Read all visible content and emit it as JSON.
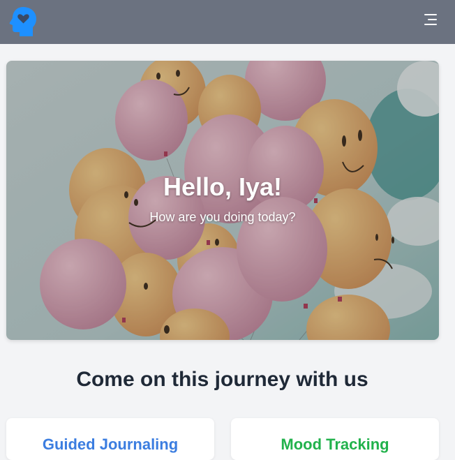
{
  "header": {
    "logo_icon": "head-heart-icon",
    "menu_icon": "hamburger-menu-icon",
    "background_color": "#6b7280",
    "logo_color": "#1e90ff"
  },
  "hero": {
    "greeting": "Hello, Iya!",
    "subtitle": "How are you doing today?",
    "image": "smiley-balloons"
  },
  "section": {
    "heading": "Come on this journey with us"
  },
  "features": [
    {
      "title": "Guided Journaling",
      "color": "#3b7de0"
    },
    {
      "title": "Mood Tracking",
      "color": "#22b24c"
    }
  ]
}
